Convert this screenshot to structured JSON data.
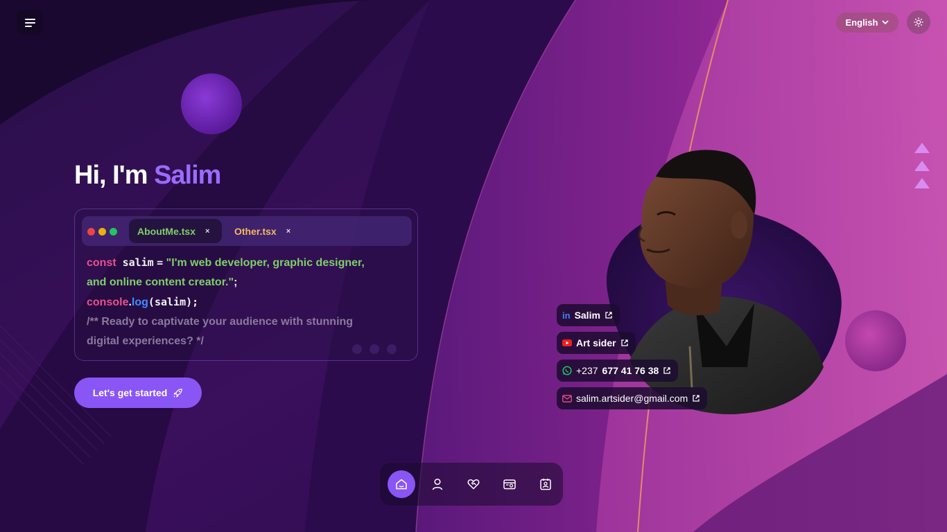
{
  "header": {
    "menu_icon": "hamburger-menu-icon",
    "language": "English",
    "theme_icon": "sun-icon"
  },
  "hero": {
    "greeting": "Hi, I'm",
    "name": "Salim",
    "cta_label": "Let's get started",
    "cta_icon": "rocket-icon"
  },
  "code_window": {
    "tabs": [
      {
        "label": "AboutMe.tsx",
        "close": "×"
      },
      {
        "label": "Other.tsx",
        "close": "×"
      }
    ],
    "lines": {
      "l1_kw": "const",
      "l1_var": "salim",
      "l1_eq": "=",
      "l1_str": "\"I'm web developer, graphic designer,",
      "l2_str": "and online content creator.\"",
      "l2_semi": ";",
      "l3_obj": "console",
      "l3_dot": ".",
      "l3_fn": "log",
      "l3_args": "(salim);",
      "l4_comment": "/** Ready to captivate your audience with stunning",
      "l5_comment": "digital experiences? */"
    }
  },
  "social": {
    "linkedin": {
      "label": "Salim",
      "icon": "linkedin-icon"
    },
    "youtube": {
      "label": "Art sider",
      "icon": "youtube-icon"
    },
    "whatsapp": {
      "prefix": "+237",
      "number": "677 41 76 38",
      "icon": "whatsapp-icon"
    },
    "email": {
      "label": "salim.artsider@gmail.com",
      "icon": "mail-icon"
    }
  },
  "bottom_nav": {
    "items": [
      {
        "icon": "home-icon",
        "active": true
      },
      {
        "icon": "user-icon",
        "active": false
      },
      {
        "icon": "heart-handshake-icon",
        "active": false
      },
      {
        "icon": "portfolio-icon",
        "active": false
      },
      {
        "icon": "contact-icon",
        "active": false
      }
    ]
  },
  "colors": {
    "accent": "#8a55f5",
    "name_purple": "#9b6bff",
    "keyword": "#e8508c",
    "string": "#7fcf6a",
    "function": "#3f8eff"
  }
}
